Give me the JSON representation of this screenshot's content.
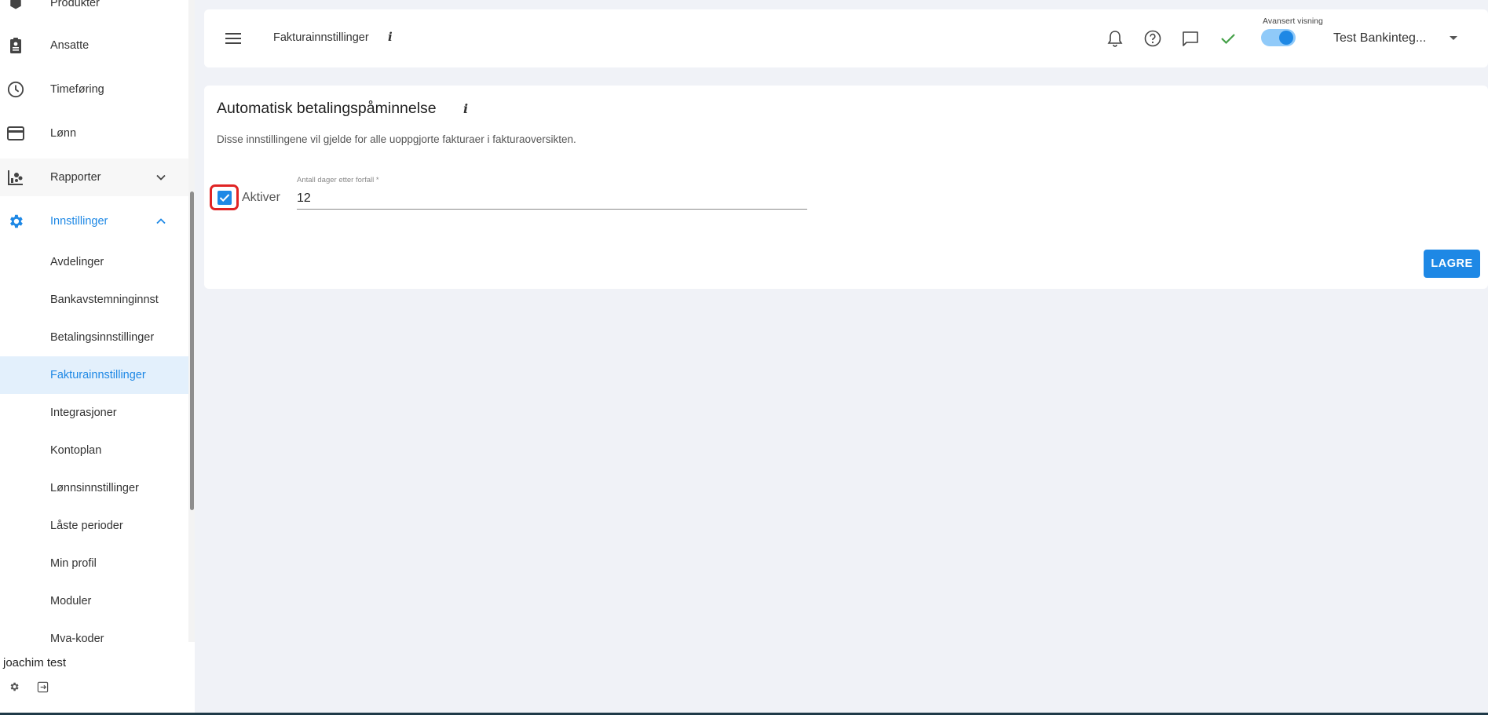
{
  "sidebar": {
    "nav": [
      {
        "label": "Produkter",
        "icon": "box-icon"
      },
      {
        "label": "Ansatte",
        "icon": "badge-icon"
      },
      {
        "label": "Timeføring",
        "icon": "clock-icon"
      },
      {
        "label": "Lønn",
        "icon": "credit-card-icon"
      },
      {
        "label": "Rapporter",
        "icon": "report-icon"
      },
      {
        "label": "Innstillinger",
        "icon": "gear-icon"
      }
    ],
    "sub_items": [
      "Avdelinger",
      "Bankavstemninginnst",
      "Betalingsinnstillinger",
      "Fakturainnstillinger",
      "Integrasjoner",
      "Kontoplan",
      "Lønnsinnstillinger",
      "Låste perioder",
      "Min profil",
      "Moduler",
      "Mva-koder"
    ],
    "selected_sub_item": "Fakturainnstillinger",
    "user_name": "joachim test"
  },
  "topbar": {
    "title": "Fakturainnstillinger",
    "info_glyph": "i",
    "advanced_view_label": "Avansert visning",
    "advanced_view_on": true,
    "company_name": "Test Bankinteg..."
  },
  "card": {
    "title": "Automatisk betalingspåminnelse",
    "info_glyph": "i",
    "description": "Disse innstillingene vil gjelde for alle uoppgjorte fakturaer i fakturaoversikten.",
    "checkbox_label": "Aktiver",
    "checkbox_checked": true,
    "field_label": "Antall dager etter forfall *",
    "field_value": "12",
    "save_label": "LAGRE"
  },
  "colors": {
    "accent": "#1e88e5",
    "highlight": "#e02424",
    "success": "#43a047"
  }
}
